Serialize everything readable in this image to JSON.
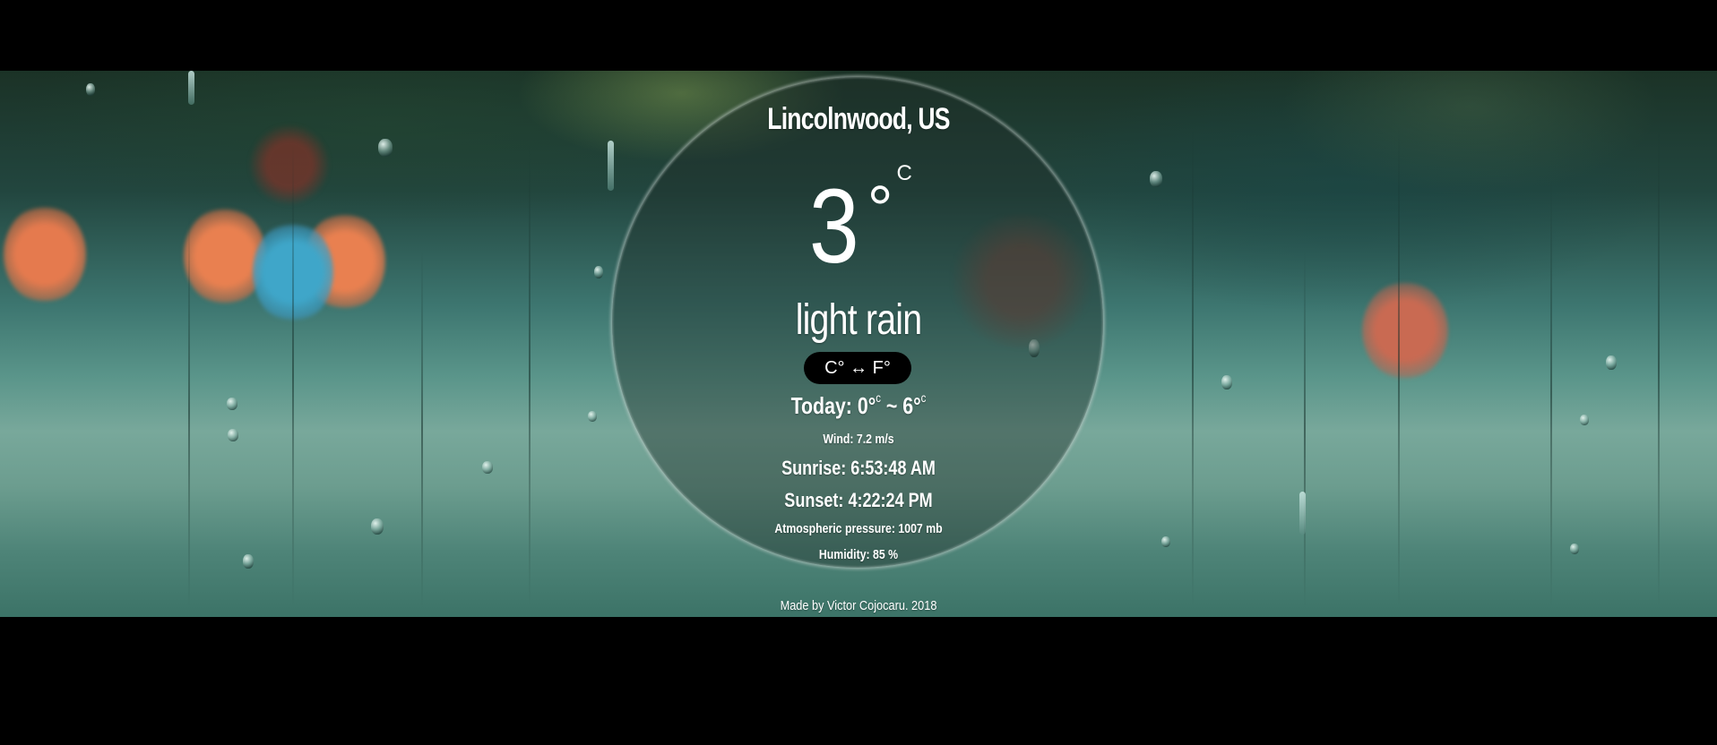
{
  "weather": {
    "location": "Lincolnwood, US",
    "temperature": "3",
    "degree_symbol": "°",
    "unit": "C",
    "description": "light rain",
    "toggle_label": "C° ↔ F°",
    "today_label": "Today:",
    "today_low": "0°",
    "today_low_unit": "c",
    "today_separator": "~",
    "today_high": "6°",
    "today_high_unit": "c",
    "wind": "Wind: 7.2 m/s",
    "sunrise": "Sunrise: 6:53:48 AM",
    "sunset": "Sunset: 4:22:24 PM",
    "pressure": "Atmospheric pressure: 1007 mb",
    "humidity": "Humidity: 85 %"
  },
  "footer": {
    "credit": "Made by Victor Cojocaru. 2018"
  },
  "colors": {
    "page_background": "#000000",
    "toggle_background": "#000000",
    "text": "#ffffff"
  }
}
